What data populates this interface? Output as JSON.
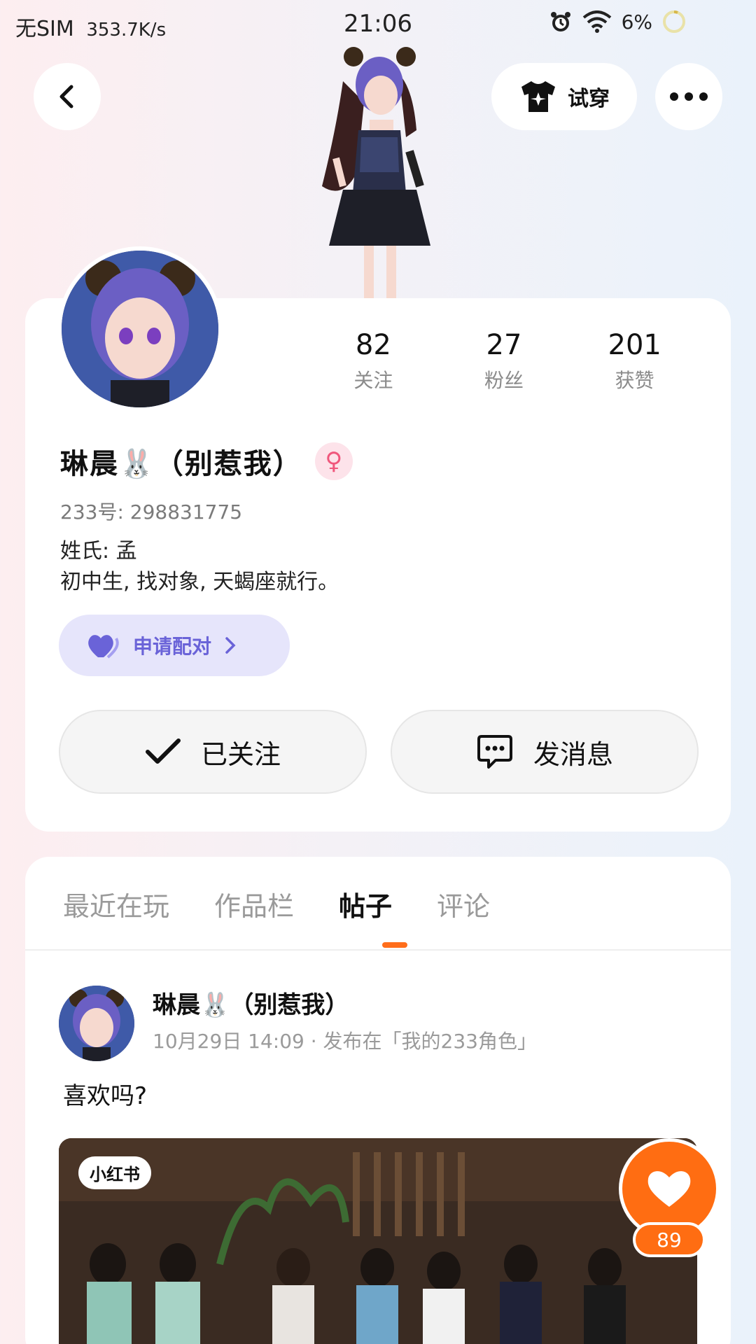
{
  "status_bar": {
    "carrier": "无SIM",
    "speed": "353.7K/s",
    "time": "21:06",
    "battery": "6%"
  },
  "header": {
    "tryon_label": "试穿"
  },
  "profile": {
    "stats": [
      {
        "num": "82",
        "label": "关注"
      },
      {
        "num": "27",
        "label": "粉丝"
      },
      {
        "num": "201",
        "label": "获赞"
      }
    ],
    "name": "琳晨🐰（别惹我）",
    "gender_symbol": "♀",
    "uid": "233号: 298831775",
    "bio_line1": "姓氏: 孟",
    "bio_line2": "初中生, 找对象, 天蝎座就行。",
    "match_label": "申请配对",
    "followed_label": "已关注",
    "message_label": "发消息"
  },
  "tabs": [
    "最近在玩",
    "作品栏",
    "帖子",
    "评论"
  ],
  "post": {
    "author": "琳晨🐰（别惹我）",
    "meta": "10月29日 14:09 · 发布在「我的233角色」",
    "text": "喜欢吗?",
    "image_badge": "小红书",
    "likes": "89"
  },
  "colors": {
    "accent_orange": "#ff6d12",
    "match_purple": "#6a63d8",
    "gender_pink": "#f0577c"
  }
}
